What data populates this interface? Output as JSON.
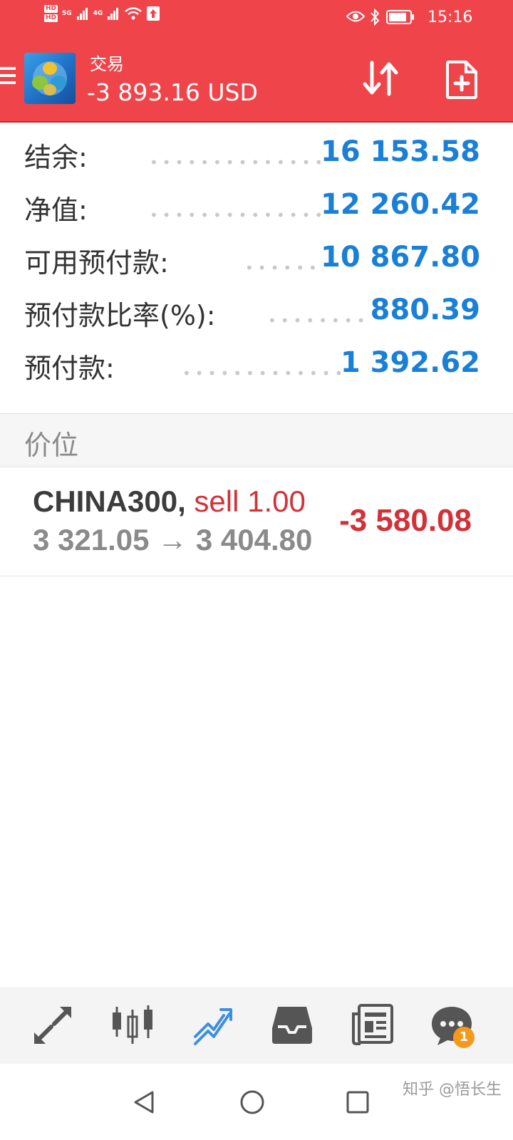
{
  "status_bar": {
    "hd1": "HD",
    "hd2": "HD",
    "net1": "5G",
    "net2": "4G",
    "time": "15:16"
  },
  "toolbar": {
    "title": "交易",
    "subtitle": "-3 893.16 USD"
  },
  "summary": [
    {
      "label": "结余:",
      "value": "16 153.58"
    },
    {
      "label": "净值:",
      "value": "12 260.42"
    },
    {
      "label": "可用预付款:",
      "value": "10 867.80"
    },
    {
      "label": "预付款比率(%):",
      "value": "880.39"
    },
    {
      "label": "预付款:",
      "value": "1 392.62"
    }
  ],
  "section_title": "价位",
  "position": {
    "symbol": "CHINA300,",
    "type": "sell 1.00",
    "open_price": "3 321.05",
    "arrow": "→",
    "current_price": "3 404.80",
    "profit": "-3 580.08"
  },
  "bottom_nav": {
    "items": [
      {
        "icon": "quotes-icon"
      },
      {
        "icon": "chart-icon"
      },
      {
        "icon": "trade-icon",
        "active": true
      },
      {
        "icon": "history-icon"
      },
      {
        "icon": "news-icon"
      },
      {
        "icon": "chat-icon",
        "badge": "1"
      }
    ]
  },
  "watermark": "知乎 @悟长生",
  "colors": {
    "header": "#f0444b",
    "value_blue": "#1a7fd6",
    "loss_red": "#d23138",
    "active_nav": "#3d8fe0"
  }
}
